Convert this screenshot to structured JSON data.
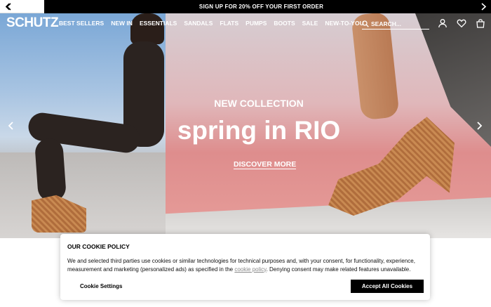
{
  "promo": {
    "text": "SIGN UP FOR 20% OFF YOUR FIRST ORDER"
  },
  "header": {
    "logo": "SCHUTZ",
    "nav": [
      "BEST SELLERS",
      "NEW IN",
      "ESSENTIALS",
      "SANDALS",
      "FLATS",
      "PUMPS",
      "BOOTS",
      "SALE",
      "NEW-TO-YOU"
    ],
    "search_placeholder": "SEARCH...",
    "icons": [
      "account-icon",
      "heart-icon",
      "bag-icon"
    ]
  },
  "hero": {
    "eyebrow": "NEW COLLECTION",
    "title": "spring in RIO",
    "cta": "DISCOVER MORE"
  },
  "cookie": {
    "title": "OUR COOKIE POLICY",
    "body_before": "We and selected third parties use cookies or similar technologies for technical purposes and, with your consent, for functionality, experience, measurement and marketing (personalized ads) as specified in the ",
    "link": "cookie policy",
    "body_after": ". Denying consent may make related features unavailable.",
    "settings_label": "Cookie Settings",
    "accept_label": "Accept All Cookies"
  },
  "colors": {
    "promo_bg": "#000000",
    "accent_button": "#000000",
    "hero_pink": "#de8d8d"
  }
}
